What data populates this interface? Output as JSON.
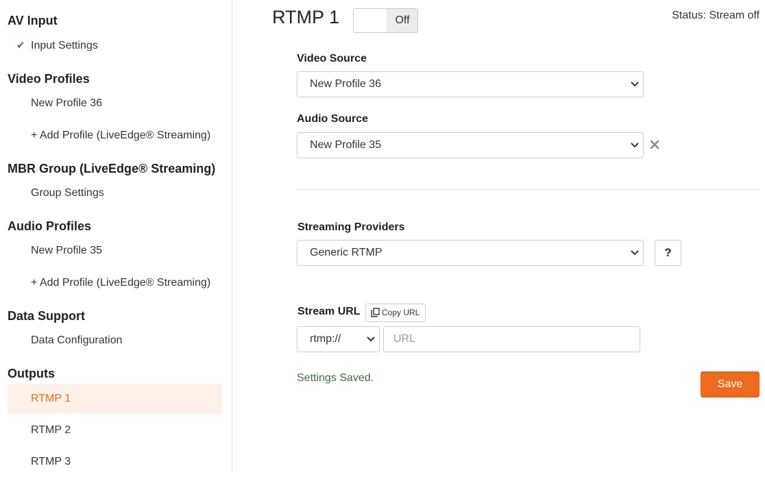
{
  "sidebar": {
    "av_input": {
      "title": "AV Input",
      "items": [
        "Input Settings"
      ]
    },
    "video_profiles": {
      "title": "Video Profiles",
      "items": [
        "New Profile 36",
        "+ Add Profile (LiveEdge® Streaming)"
      ]
    },
    "mbr_group": {
      "title": "MBR Group (LiveEdge® Streaming)",
      "items": [
        "Group Settings"
      ]
    },
    "audio_profiles": {
      "title": "Audio Profiles",
      "items": [
        "New Profile 35",
        "+ Add Profile (LiveEdge® Streaming)"
      ]
    },
    "data_support": {
      "title": "Data Support",
      "items": [
        "Data Configuration"
      ]
    },
    "outputs": {
      "title": "Outputs",
      "items": [
        "RTMP 1",
        "RTMP 2",
        "RTMP 3"
      ],
      "active": "RTMP 1"
    }
  },
  "header": {
    "title": "RTMP 1",
    "toggle_label": "Off",
    "status": "Status: Stream off"
  },
  "form": {
    "video_source": {
      "label": "Video Source",
      "value": "New Profile 36"
    },
    "audio_source": {
      "label": "Audio Source",
      "value": "New Profile 35"
    },
    "streaming_providers": {
      "label": "Streaming Providers",
      "value": "Generic RTMP",
      "help_label": "?"
    },
    "stream_url": {
      "label": "Stream URL",
      "copy_label": "Copy URL",
      "protocol": "rtmp://",
      "placeholder": "URL",
      "value": ""
    }
  },
  "footer": {
    "message": "Settings Saved.",
    "save_label": "Save"
  },
  "colors": {
    "accent": "#ec6b1f",
    "success": "#3d6b3f",
    "active_bg": "#fdf1ea"
  },
  "icons": {
    "check": "check-icon",
    "chevron": "chevron-down-icon",
    "clear": "close-icon",
    "copy": "copy-icon"
  }
}
